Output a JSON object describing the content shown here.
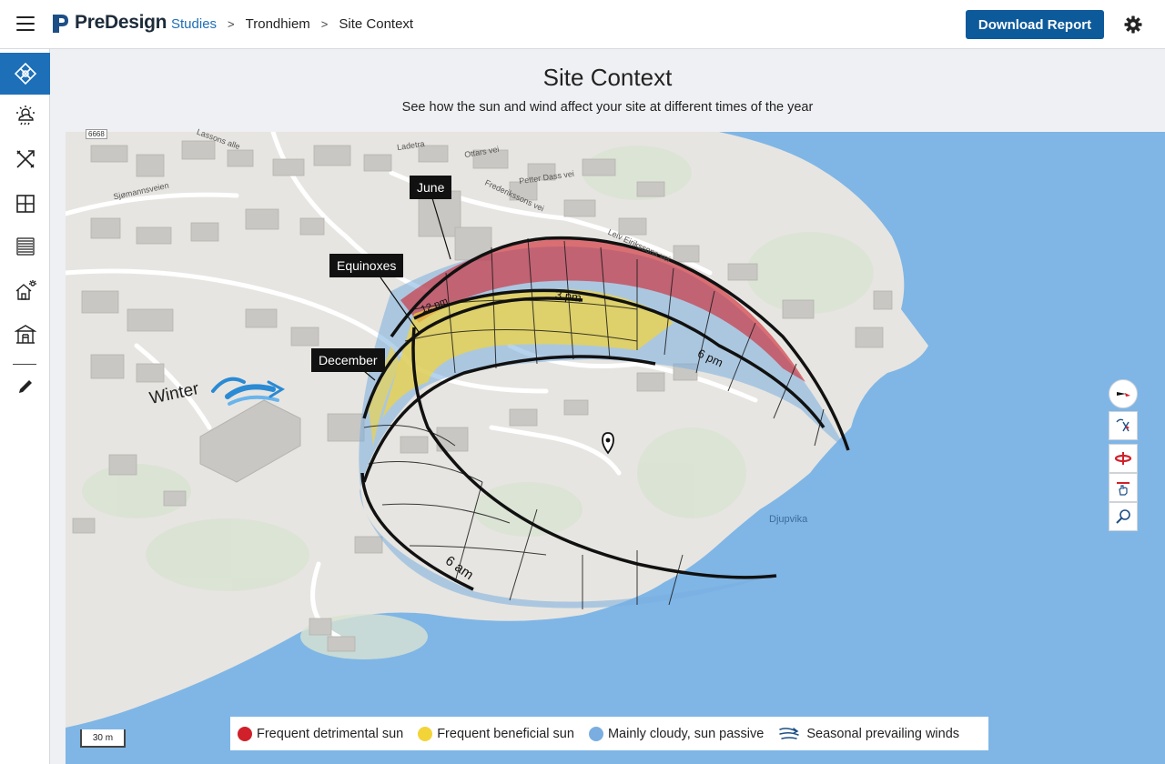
{
  "app": {
    "brand": "PreDesign"
  },
  "breadcrumb": {
    "studies": "Studies",
    "project": "Trondhiem",
    "current": "Site Context",
    "separator": ">"
  },
  "header": {
    "download_label": "Download Report"
  },
  "page": {
    "title": "Site Context",
    "subtitle": "See how the sun and wind affect your site at different times of the year"
  },
  "sidebar": {
    "items": [
      {
        "name": "site-context-icon",
        "active": true
      },
      {
        "name": "weather-icon",
        "active": false
      },
      {
        "name": "tools-icon",
        "active": false
      },
      {
        "name": "window-icon",
        "active": false
      },
      {
        "name": "facade-icon",
        "active": false
      },
      {
        "name": "home-energy-icon",
        "active": false
      },
      {
        "name": "pavilion-icon",
        "active": false
      },
      {
        "name": "pencil-icon",
        "active": false
      }
    ]
  },
  "map": {
    "callouts": {
      "june": "June",
      "equinoxes": "Equinoxes",
      "december": "December"
    },
    "wind_label": "Winter",
    "time_labels": {
      "t12pm": "12 pm",
      "t3pm": "3 pm",
      "t6pm": "6 pm",
      "t6am": "6 am"
    },
    "place_label": "Djupvika",
    "street_labels": {
      "road_number": "6668",
      "s1": "Sjømannsveien",
      "s2": "Leiv Eirikssons vei",
      "s3": "Ottars vei",
      "s4": "Petter Dass vei",
      "s5": "Ladetra",
      "s6": "Frederikssons vei",
      "s7": "Lassons alle"
    },
    "scale_label": "30 m"
  },
  "legend": [
    {
      "label": "Frequent detrimental sun",
      "color": "#d0202a"
    },
    {
      "label": "Frequent beneficial sun",
      "color": "#f3d438"
    },
    {
      "label": "Mainly cloudy, sun passive",
      "color": "#7aaee0"
    },
    {
      "label": "Seasonal prevailing winds",
      "icon": "wind-arrows-icon"
    }
  ],
  "colors": {
    "accent": "#0d5a9b",
    "link": "#1d6fb8",
    "water": "#7fb6e6",
    "land": "#e7e5e1"
  }
}
